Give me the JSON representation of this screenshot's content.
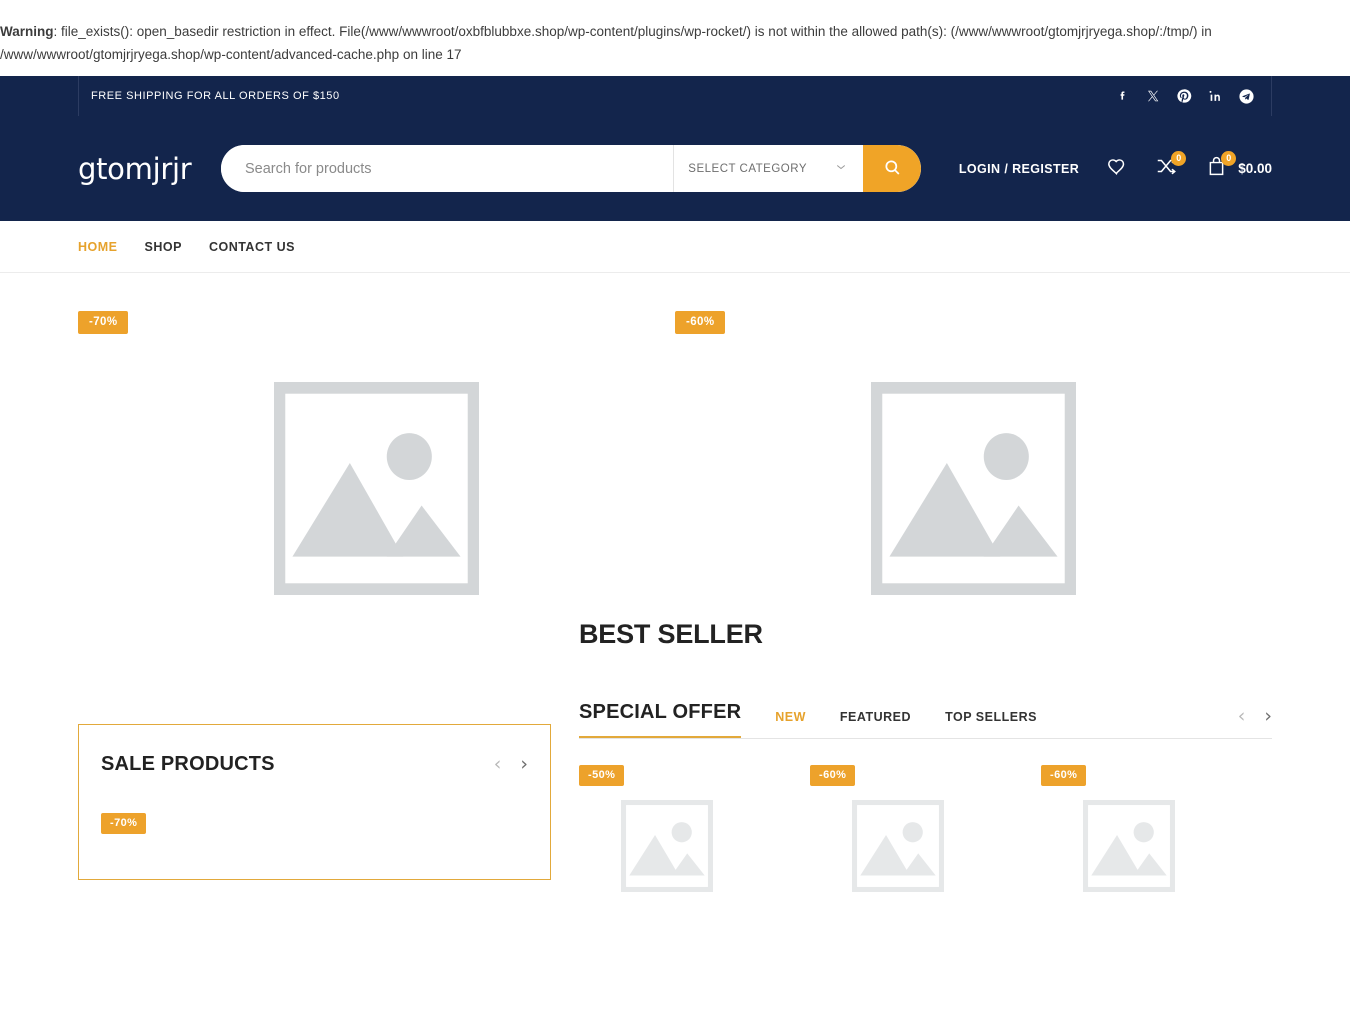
{
  "php_warning": {
    "label": "Warning",
    "line1": ": file_exists(): open_basedir restriction in effect. File(/www/wwwroot/oxbfblubbxe.shop/wp-content/plugins/wp-rocket/) is not within the allowed path(s): (/www/wwwroot/gtomjrjryega.shop/:/tmp/) in",
    "line2": "/www/wwwroot/gtomjrjryega.shop/wp-content/advanced-cache.php on line 17"
  },
  "topbar": {
    "promo": "FREE SHIPPING FOR ALL ORDERS OF $150",
    "socials": [
      {
        "name": "facebook-icon",
        "label": "Facebook"
      },
      {
        "name": "x-twitter-icon",
        "label": "X"
      },
      {
        "name": "pinterest-icon",
        "label": "Pinterest"
      },
      {
        "name": "linkedin-icon",
        "label": "LinkedIn"
      },
      {
        "name": "telegram-icon",
        "label": "Telegram"
      }
    ]
  },
  "header": {
    "logo": "gtomjrjr",
    "search_placeholder": "Search for products",
    "search_value": "",
    "category_label": "SELECT CATEGORY",
    "login_label": "LOGIN / REGISTER",
    "compare_count": "0",
    "cart_count": "0",
    "cart_amount": "$0.00"
  },
  "nav": {
    "items": [
      {
        "label": "HOME",
        "active": true
      },
      {
        "label": "SHOP",
        "active": false
      },
      {
        "label": "CONTACT US",
        "active": false
      }
    ]
  },
  "hero": {
    "products": [
      {
        "badge": "-70%"
      },
      {
        "badge": "-60%"
      }
    ]
  },
  "best_seller": {
    "title": "BEST SELLER"
  },
  "sale_products": {
    "title": "SALE PRODUCTS",
    "prev": "‹",
    "next": "›",
    "items": [
      {
        "badge": "-70%"
      }
    ]
  },
  "special_offer": {
    "title": "SPECIAL OFFER",
    "tabs": [
      {
        "label": "NEW",
        "active": true
      },
      {
        "label": "FEATURED",
        "active": false
      },
      {
        "label": "TOP SELLERS",
        "active": false
      }
    ],
    "prev": "‹",
    "next": "›",
    "items": [
      {
        "badge": "-50%"
      },
      {
        "badge": "-60%"
      },
      {
        "badge": "-60%"
      }
    ]
  },
  "colors": {
    "header_bg": "#13254c",
    "accent": "#eda22b",
    "accent_text": "#e6a22c",
    "placeholder_gray": "#d5d7d9"
  }
}
